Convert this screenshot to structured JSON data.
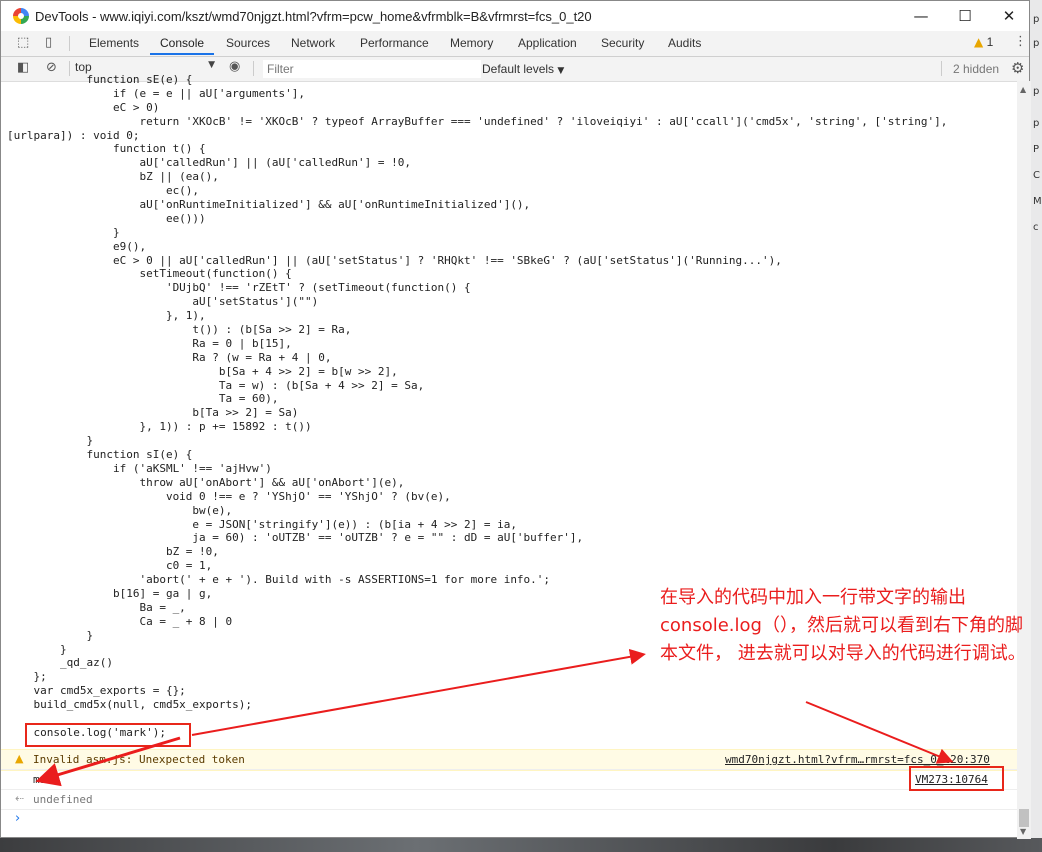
{
  "window": {
    "title": "DevTools - www.iqiyi.com/kszt/wmd70njgzt.html?vfrm=pcw_home&vfrmblk=B&vfrmrst=fcs_0_t20"
  },
  "tabs": [
    "Elements",
    "Console",
    "Sources",
    "Network",
    "Performance",
    "Memory",
    "Application",
    "Security",
    "Audits"
  ],
  "active_tab": "Console",
  "warning_count": "1",
  "toolbar": {
    "context": "top",
    "filter_placeholder": "Filter",
    "levels": "Default levels",
    "hidden": "2 hidden"
  },
  "code_lines": [
    "            function sE(e) {",
    "                if (e = e || aU['arguments'],",
    "                eC > 0)",
    "                    return 'XKOcB' != 'XKOcB' ? typeof ArrayBuffer === 'undefined' ? 'iloveiqiyi' : aU['ccall']('cmd5x', 'string', ['string'],",
    "[urlpara]) : void 0;",
    "                function t() {",
    "                    aU['calledRun'] || (aU['calledRun'] = !0,",
    "                    bZ || (ea(),",
    "                        ec(),",
    "                    aU['onRuntimeInitialized'] && aU['onRuntimeInitialized'](),",
    "                        ee()))",
    "                }",
    "                e9(),",
    "                eC > 0 || aU['calledRun'] || (aU['setStatus'] ? 'RHQkt' !== 'SBkeG' ? (aU['setStatus']('Running...'),",
    "                    setTimeout(function() {",
    "                        'DUjbQ' !== 'rZEtT' ? (setTimeout(function() {",
    "                            aU['setStatus'](\"\")",
    "                        }, 1),",
    "                            t()) : (b[Sa >> 2] = Ra,",
    "                            Ra = 0 | b[15],",
    "                            Ra ? (w = Ra + 4 | 0,",
    "                                b[Sa + 4 >> 2] = b[w >> 2],",
    "                                Ta = w) : (b[Sa + 4 >> 2] = Sa,",
    "                                Ta = 60),",
    "                            b[Ta >> 2] = Sa)",
    "                    }, 1)) : p += 15892 : t())",
    "            }",
    "            function sI(e) {",
    "                if ('aKSML' !== 'ajHvw')",
    "                    throw aU['onAbort'] && aU['onAbort'](e),",
    "                        void 0 !== e ? 'YShjO' == 'YShjO' ? (bv(e),",
    "                            bw(e),",
    "                            e = JSON['stringify'](e)) : (b[ia + 4 >> 2] = ia,",
    "                            ja = 60) : 'oUTZB' == 'oUTZB' ? e = \"\" : dD = aU['buffer'],",
    "                        bZ = !0,",
    "                        c0 = 1,",
    "                    'abort(' + e + '). Build with -s ASSERTIONS=1 for more info.';",
    "                b[16] = ga | g,",
    "                    Ba = _,",
    "                    Ca = _ + 8 | 0",
    "            }",
    "        }",
    "        _qd_az()",
    "    };",
    "    var cmd5x_exports = {};",
    "    build_cmd5x(null, cmd5x_exports);",
    "",
    "    console.log('mark');"
  ],
  "warning": {
    "text": "Invalid asm.js: Unexpected token",
    "source": "wmd70njgzt.html?vfrm…rmrst=fcs_0_t20:370"
  },
  "log": {
    "text": "mark",
    "source": "VM273:10764"
  },
  "result": {
    "text": "undefined"
  },
  "annotation": "在导入的代码中加入一行带文字的输出console.log（），然后就可以看到右下角的脚本文件， 进去就可以对导入的代码进行调试。",
  "colors": {
    "annotation": "#ea1d1d",
    "tab_accent": "#1a73e8",
    "warning_bg": "#fffbe5"
  }
}
